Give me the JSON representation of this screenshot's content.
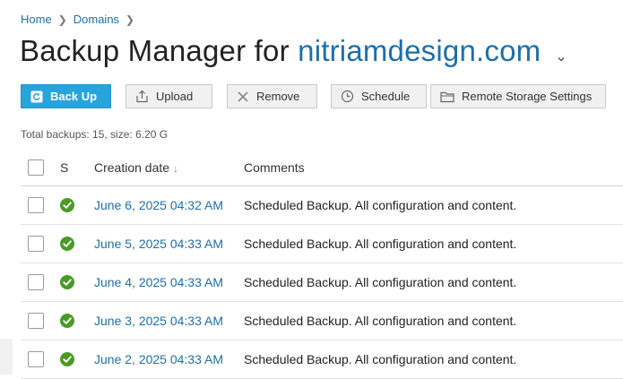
{
  "breadcrumb": {
    "items": [
      "Home",
      "Domains"
    ]
  },
  "title": {
    "prefix": "Backup Manager for",
    "domain": "nitriamdesign.com"
  },
  "toolbar": {
    "backup_label": "Back Up",
    "upload_label": "Upload",
    "remove_label": "Remove",
    "schedule_label": "Schedule",
    "remote_label": "Remote Storage Settings"
  },
  "summary": "Total backups: 15, size: 6.20 G",
  "table": {
    "headers": {
      "status": "S",
      "date": "Creation date",
      "comments": "Comments"
    },
    "sort_indicator": "↓",
    "rows": [
      {
        "date": "June 6, 2025 04:32 AM",
        "comment": "Scheduled Backup. All configuration and content."
      },
      {
        "date": "June 5, 2025 04:33 AM",
        "comment": "Scheduled Backup. All configuration and content."
      },
      {
        "date": "June 4, 2025 04:33 AM",
        "comment": "Scheduled Backup. All configuration and content."
      },
      {
        "date": "June 3, 2025 04:33 AM",
        "comment": "Scheduled Backup. All configuration and content."
      },
      {
        "date": "June 2, 2025 04:33 AM",
        "comment": "Scheduled Backup. All configuration and content."
      }
    ]
  },
  "colors": {
    "link": "#1e6fa8",
    "primary_button": "#28a4dd",
    "success": "#4a9b26"
  },
  "icons": [
    "chevron-right-icon",
    "chevron-down-icon",
    "backup-icon",
    "upload-icon",
    "remove-icon",
    "clock-icon",
    "folder-icon",
    "success-check-icon"
  ]
}
